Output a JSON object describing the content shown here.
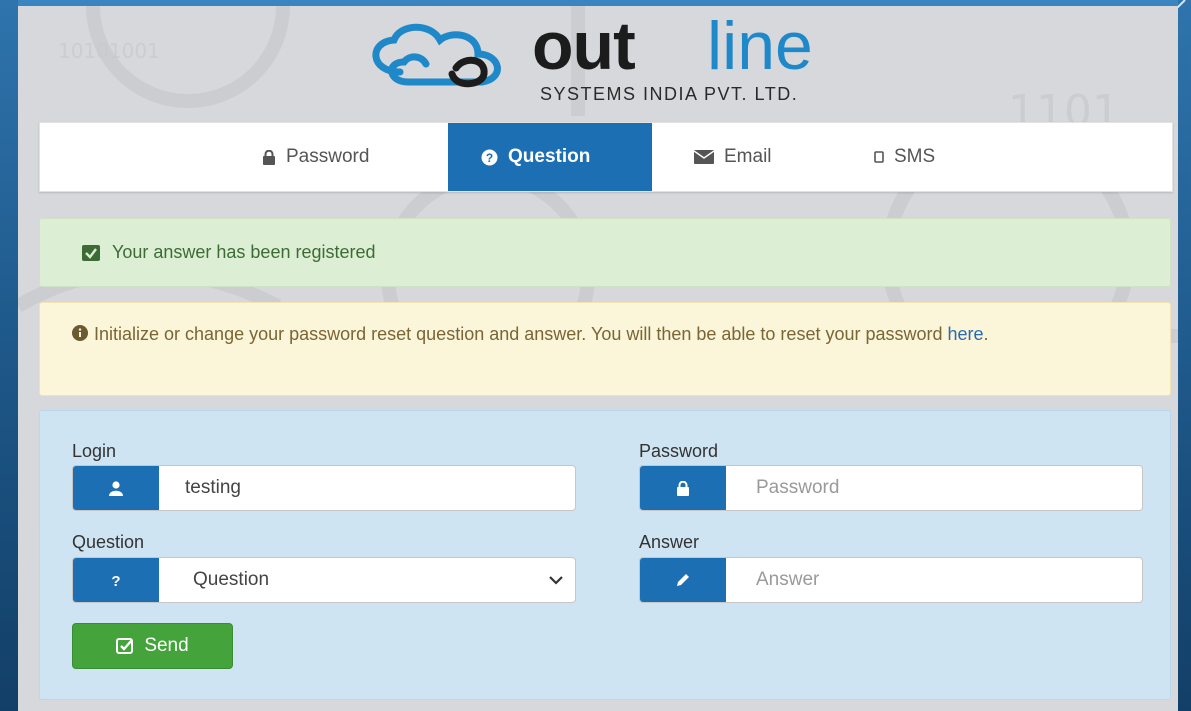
{
  "logo": {
    "brand_bold": "out",
    "brand_light": "line",
    "subtitle": "SYSTEMS INDIA PVT. LTD."
  },
  "tabs": [
    {
      "label": "Password",
      "icon": "lock-icon",
      "active": false
    },
    {
      "label": "Question",
      "icon": "question-circle-icon",
      "active": true
    },
    {
      "label": "Email",
      "icon": "envelope-icon",
      "active": false
    },
    {
      "label": "SMS",
      "icon": "mobile-icon",
      "active": false
    }
  ],
  "alerts": {
    "success": "Your answer has been registered",
    "warning_text": "Initialize or change your password reset question and answer. You will then be able to reset your password ",
    "warning_link": "here",
    "warning_end": "."
  },
  "form": {
    "login_label": "Login",
    "login_value": "testing",
    "password_label": "Password",
    "password_placeholder": "Password",
    "question_label": "Question",
    "question_selected": "Question",
    "answer_label": "Answer",
    "answer_placeholder": "Answer",
    "send_label": "Send"
  },
  "colors": {
    "primary": "#1b6fb2",
    "success_bg": "#dcefd4",
    "warning_bg": "#fbf5d9",
    "panel_bg": "#cfe4f3",
    "send": "#45a33c",
    "brand_blue": "#1f88c8"
  }
}
